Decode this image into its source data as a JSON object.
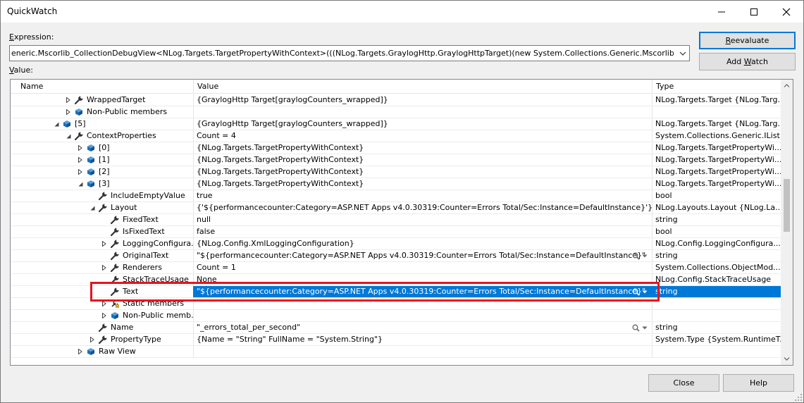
{
  "window": {
    "title": "QuickWatch"
  },
  "expression": {
    "label_prefix": "E",
    "label_rest": "xpression:",
    "value": "eneric.Mscorlib_CollectionDebugView<NLog.Targets.TargetPropertyWithContext>(((NLog.Targets.GraylogHttp.GraylogHttpTarget)(new System.Collections.Generic.Mscorlib_Collec"
  },
  "value_label_prefix": "V",
  "value_label_rest": "alue:",
  "buttons": {
    "reevaluate_prefix": "R",
    "reevaluate_rest": "eevaluate",
    "add_watch_prefix": "Add ",
    "add_watch_u": "W",
    "add_watch_rest": "atch",
    "close": "Close",
    "help": "Help"
  },
  "grid": {
    "columns": {
      "name": "Name",
      "value": "Value",
      "type": "Type"
    },
    "rows": [
      {
        "indent": 4,
        "expander": "collapsed",
        "icon": "wrench-icon",
        "name": "WrappedTarget",
        "value": "{GraylogHttp Target[graylogCounters_wrapped]}",
        "type": "NLog.Targets.Target {NLog.Targ..."
      },
      {
        "indent": 4,
        "expander": "collapsed",
        "icon": "cube-icon",
        "name": "Non-Public members",
        "value": "",
        "type": ""
      },
      {
        "indent": 3,
        "expander": "expanded",
        "icon": "cube-icon",
        "name": "[5]",
        "value": "{GraylogHttp Target[graylogCounters_wrapped]}",
        "type": "NLog.Targets.Target {NLog.Targ..."
      },
      {
        "indent": 4,
        "expander": "expanded",
        "icon": "wrench-icon",
        "name": "ContextProperties",
        "value": "Count = 4",
        "type": "System.Collections.Generic.IList..."
      },
      {
        "indent": 5,
        "expander": "collapsed",
        "icon": "cube-icon",
        "name": "[0]",
        "value": "{NLog.Targets.TargetPropertyWithContext}",
        "type": "NLog.Targets.TargetPropertyWi..."
      },
      {
        "indent": 5,
        "expander": "collapsed",
        "icon": "cube-icon",
        "name": "[1]",
        "value": "{NLog.Targets.TargetPropertyWithContext}",
        "type": "NLog.Targets.TargetPropertyWi..."
      },
      {
        "indent": 5,
        "expander": "collapsed",
        "icon": "cube-icon",
        "name": "[2]",
        "value": "{NLog.Targets.TargetPropertyWithContext}",
        "type": "NLog.Targets.TargetPropertyWi..."
      },
      {
        "indent": 5,
        "expander": "expanded",
        "icon": "cube-icon",
        "name": "[3]",
        "value": "{NLog.Targets.TargetPropertyWithContext}",
        "type": "NLog.Targets.TargetPropertyWi..."
      },
      {
        "indent": 6,
        "expander": "none",
        "icon": "wrench-icon",
        "name": "IncludeEmptyValue",
        "value": "true",
        "type": "bool"
      },
      {
        "indent": 6,
        "expander": "expanded",
        "icon": "wrench-icon",
        "name": "Layout",
        "value": "{'${performancecounter:Category=ASP.NET Apps v4.0.30319:Counter=Errors Total/Sec:Instance=DefaultInstance}'}",
        "type": "NLog.Layouts.Layout {NLog.La..."
      },
      {
        "indent": 7,
        "expander": "none",
        "icon": "wrench-icon",
        "name": "FixedText",
        "value": "null",
        "type": "string"
      },
      {
        "indent": 7,
        "expander": "none",
        "icon": "wrench-icon",
        "name": "IsFixedText",
        "value": "false",
        "type": "bool"
      },
      {
        "indent": 7,
        "expander": "collapsed",
        "icon": "wrench-icon",
        "name": "LoggingConfigura...",
        "value": "{NLog.Config.XmlLoggingConfiguration}",
        "type": "NLog.Config.LoggingConfigura..."
      },
      {
        "indent": 7,
        "expander": "none",
        "icon": "wrench-icon",
        "name": "OriginalText",
        "value": "\"${performancecounter:Category=ASP.NET Apps v4.0.30319:Counter=Errors Total/Sec:Instance=DefaultInstance}\"",
        "type": "string",
        "tools": true
      },
      {
        "indent": 7,
        "expander": "collapsed",
        "icon": "wrench-icon",
        "name": "Renderers",
        "value": "Count = 1",
        "type": "System.Collections.ObjectMod..."
      },
      {
        "indent": 7,
        "expander": "none",
        "icon": "wrench-icon",
        "name": "StackTraceUsage",
        "value": "None",
        "type": "NLog.Config.StackTraceUsage"
      },
      {
        "indent": 7,
        "expander": "none",
        "icon": "wrench-icon",
        "name": "Text",
        "value": "\"${performancecounter:Category=ASP.NET Apps v4.0.30319:Counter=Errors Total/Sec:Instance=DefaultInstance}\"",
        "type": "string",
        "tools": true,
        "selected": true
      },
      {
        "indent": 7,
        "expander": "collapsed",
        "icon": "static-members-icon",
        "name": "Static members",
        "value": "",
        "type": ""
      },
      {
        "indent": 7,
        "expander": "collapsed",
        "icon": "cube-icon",
        "name": "Non-Public memb...",
        "value": "",
        "type": ""
      },
      {
        "indent": 6,
        "expander": "none",
        "icon": "wrench-icon",
        "name": "Name",
        "value": "\"_errors_total_per_second\"",
        "type": "string",
        "tools": true
      },
      {
        "indent": 6,
        "expander": "collapsed",
        "icon": "wrench-icon",
        "name": "PropertyType",
        "value": "{Name = \"String\" FullName = \"System.String\"}",
        "type": "System.Type {System.RuntimeT..."
      },
      {
        "indent": 5,
        "expander": "collapsed",
        "icon": "cube-icon",
        "name": "Raw View",
        "value": "",
        "type": ""
      }
    ]
  },
  "scrollbar": {
    "position": 0.42
  },
  "colors": {
    "selection": "#0078d7",
    "highlight_box": "#e8141f",
    "cube_icon": "#1e6fb8"
  }
}
